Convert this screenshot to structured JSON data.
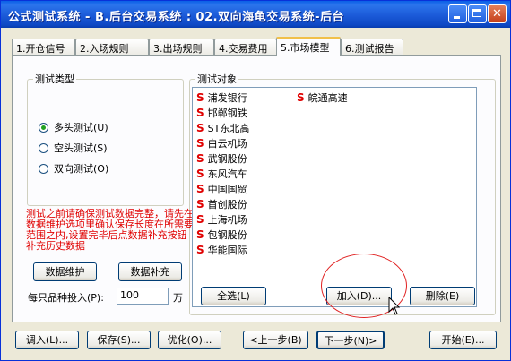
{
  "window": {
    "title": "公式测试系统 - B.后台交易系统 : 02.双向海龟交易系统-后台"
  },
  "tabs": [
    "1.开仓信号",
    "2.入场规则",
    "3.出场规则",
    "4.交易费用",
    "5.市场模型",
    "6.测试报告"
  ],
  "active_tab": "5.市场模型",
  "test_type": {
    "legend": "测试类型",
    "options": [
      "多头测试(U)",
      "空头测试(S)",
      "双向测试(O)"
    ],
    "selected": "多头测试(U)"
  },
  "warning": "测试之前请确保测试数据完整，请先在数据维护选项里确认保存长度在所需要范围之内,设置完毕后点数据补充按钮补充历史数据",
  "data_buttons": {
    "maintain": "数据维护",
    "supplement": "数据补充"
  },
  "investment": {
    "label": "每只品种投入(P):",
    "value": "100",
    "unit": "万"
  },
  "test_objects": {
    "legend": "测试对象",
    "marker": "S",
    "column1": [
      "浦发银行",
      "邯郸钢铁",
      "ST东北高",
      "白云机场",
      "武钢股份",
      "东风汽车",
      "中国国贸",
      "首创股份",
      "上海机场",
      "包钢股份",
      "华能国际"
    ],
    "column2": [
      "皖通高速"
    ],
    "buttons": {
      "select_all": "全选(L)",
      "add": "加入(D)...",
      "delete": "删除(E)"
    }
  },
  "footer": {
    "call": "调入(L)...",
    "save": "保存(S)...",
    "optimize": "优化(O)...",
    "prev": "<上一步(B)",
    "next": "下一步(N)>",
    "start": "开始(E)..."
  },
  "colors": {
    "titlebar": "#0a5fe6",
    "warning": "#e00000",
    "marker": "#e00000",
    "highlight_circle": "#e02020"
  }
}
